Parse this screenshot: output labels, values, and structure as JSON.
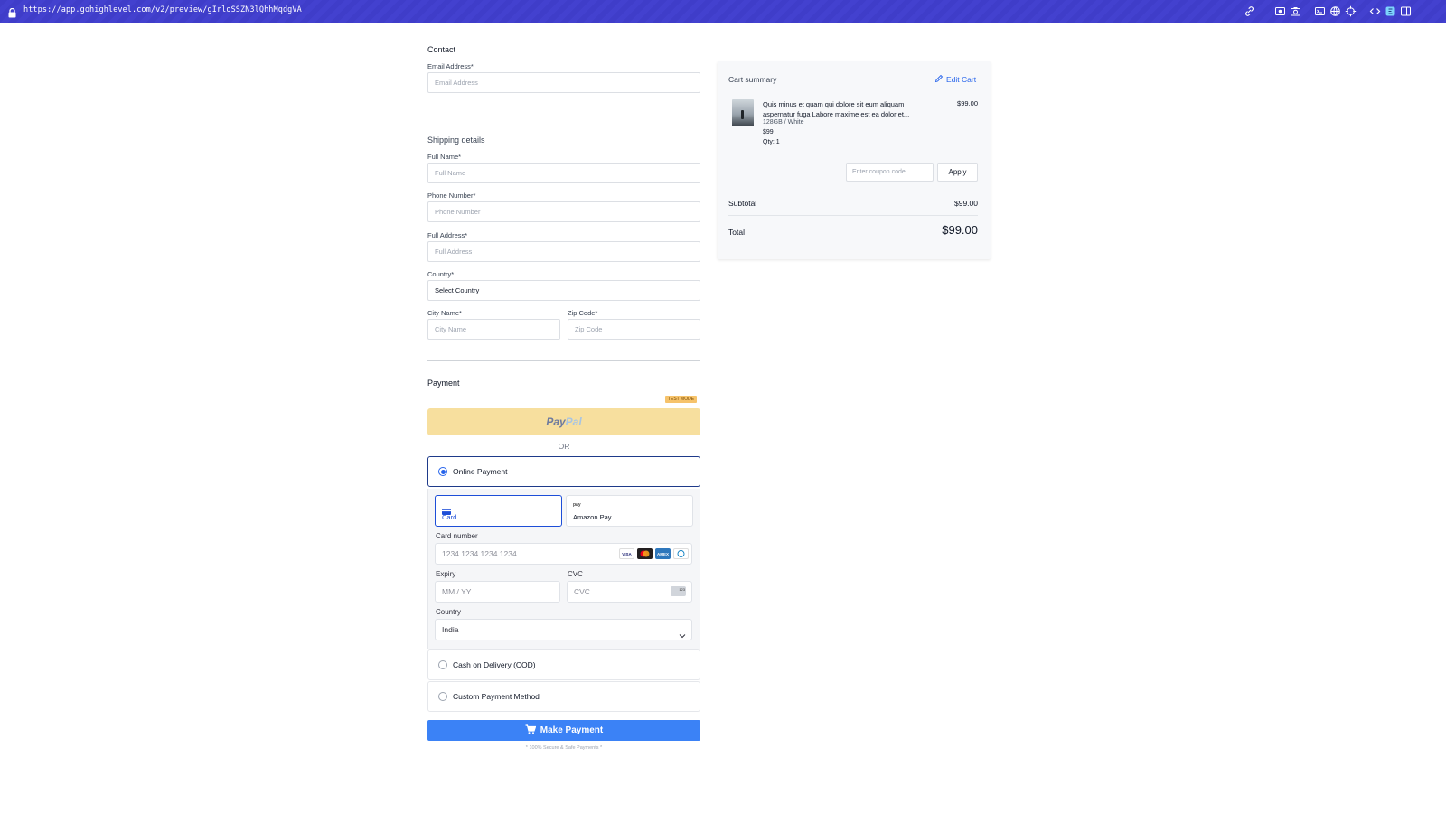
{
  "browser": {
    "url": "https://app.gohighlevel.com/v2/preview/gIrloSSZN3lQhhMqdgVA"
  },
  "contact": {
    "title": "Contact",
    "email_label": "Email Address*",
    "email_placeholder": "Email Address"
  },
  "shipping": {
    "title": "Shipping details",
    "full_name_label": "Full Name*",
    "full_name_placeholder": "Full Name",
    "phone_label": "Phone Number*",
    "phone_placeholder": "Phone Number",
    "address_label": "Full Address*",
    "address_placeholder": "Full Address",
    "country_label": "Country*",
    "country_value": "Select Country",
    "city_label": "City Name*",
    "city_placeholder": "City Name",
    "zip_label": "Zip Code*",
    "zip_placeholder": "Zip Code"
  },
  "payment": {
    "title": "Payment",
    "test_mode_badge": "TEST MODE",
    "paypal_part1": "Pay",
    "paypal_part2": "Pal",
    "or_text": "OR",
    "online_payment_label": "Online Payment",
    "tabs": [
      {
        "label": "Card",
        "icon": "card-icon",
        "active": true
      },
      {
        "label": "Amazon Pay",
        "icon": "amazon-pay-icon",
        "active": false
      }
    ],
    "amazon_pay_icon_text": "pay",
    "card_number_label": "Card number",
    "card_number_placeholder": "1234 1234 1234 1234",
    "card_brands": [
      "VISA",
      "mastercard",
      "AMEX",
      "diners"
    ],
    "expiry_label": "Expiry",
    "expiry_placeholder": "MM / YY",
    "cvc_label": "CVC",
    "cvc_placeholder": "CVC",
    "cvc_icon_text": "123",
    "country_label": "Country",
    "country_value": "India",
    "cod_label": "Cash on Delivery (COD)",
    "custom_label": "Custom Payment Method",
    "make_payment_label": "Make Payment",
    "secure_text": "* 100% Secure & Safe Payments *"
  },
  "cart": {
    "title": "Cart summary",
    "edit_label": "Edit Cart",
    "item": {
      "name": "Quis minus et quam qui dolore sit eum aliquam aspernatur fuga Labore maxime est ea dolor et...",
      "variant": "128GB / White",
      "unit_price": "$99",
      "qty": "Qty: 1",
      "price": "$99.00"
    },
    "coupon_placeholder": "Enter coupon code",
    "apply_label": "Apply",
    "subtotal_label": "Subtotal",
    "subtotal_value": "$99.00",
    "total_label": "Total",
    "total_value": "$99.00"
  },
  "colors": {
    "topbar": "#3f3dc9",
    "primary": "#3b82f6",
    "paypal_bg": "#f7df9e",
    "link": "#2563eb"
  }
}
